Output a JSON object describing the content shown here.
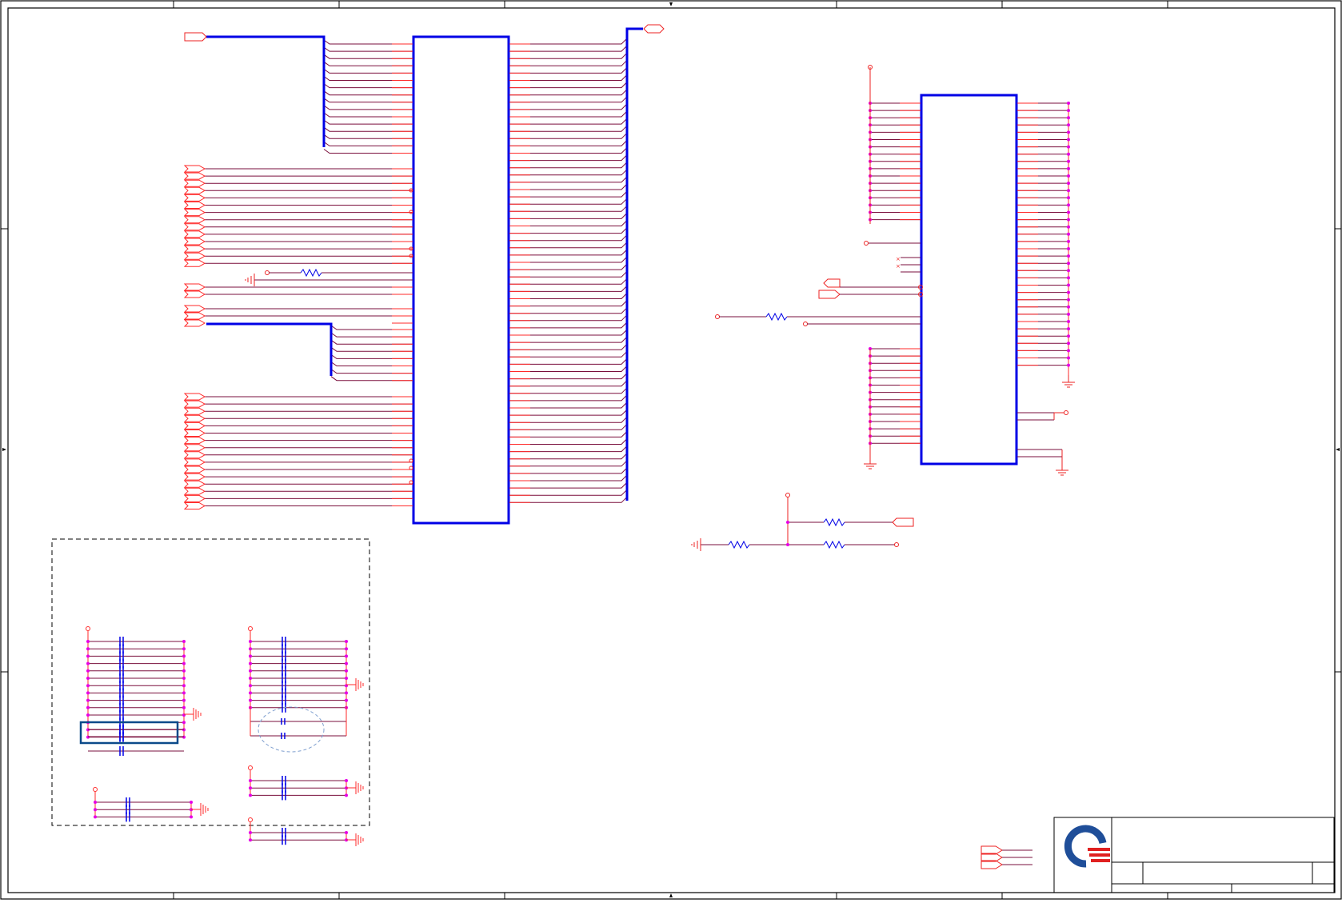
{
  "sheet": {
    "kind": "schematic",
    "colors": {
      "border": "#000000",
      "wire": "#7a0f3c",
      "pin": "#ff2a2a",
      "bus": "#0000e6",
      "junction": "#e600e6",
      "dashed_frame": "#000000",
      "capacitor": "#0000e6",
      "highlight_box": "#0b4a8a",
      "ellipse": "#7f9fcf",
      "logo_blue": "#1f4e99",
      "logo_red": "#e02020"
    }
  },
  "title_block": {
    "logo": "company-logo"
  }
}
